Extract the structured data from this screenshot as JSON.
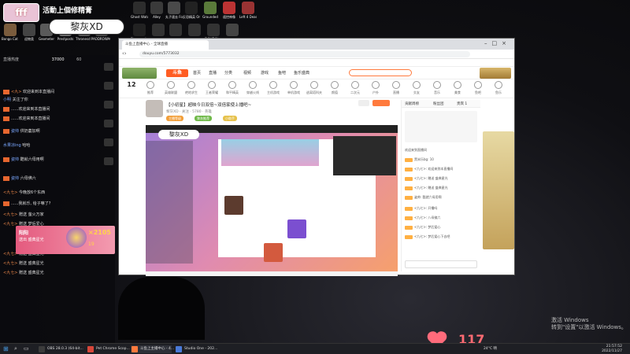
{
  "overlay": {
    "title_banner": "活動上個修精膏",
    "logo_badge": "fff",
    "streamer_name": "黎灰XD"
  },
  "desktop_icons_row1": [
    {
      "label": "Ghost Watchers",
      "color": "#2d2d2d"
    },
    {
      "label": "Alley",
      "color": "#3a3a3a"
    },
    {
      "label": "丸子速去 For Darling",
      "color": "#4a4a4a"
    },
    {
      "label": "反恐精英 Online",
      "color": "#222"
    },
    {
      "label": "Grounded",
      "color": "#5a7a3a"
    },
    {
      "label": "遥控神像",
      "color": "#b33"
    },
    {
      "label": "Left 4 Dead 2",
      "color": "#933"
    }
  ],
  "desktop_icons_row2": [
    {
      "label": "Bongo Cat Mver.exe",
      "color": "#7a5c3d"
    },
    {
      "label": "迎物类",
      "color": "#444"
    },
    {
      "label": "Geometer",
      "color": "#5a5a5a"
    },
    {
      "label": "Prestposts",
      "color": "#6a6a6a"
    },
    {
      "label": "Thronesd Party",
      "color": "#555"
    },
    {
      "label": "AODROWAGYE",
      "color": "#444"
    },
    {
      "label": "Phasmophobia",
      "color": "#222"
    },
    {
      "label": "",
      "color": "#333"
    },
    {
      "label": "",
      "color": "#333"
    },
    {
      "label": "",
      "color": "#333"
    },
    {
      "label": "FIGHT Phoenix",
      "color": "#333"
    },
    {
      "label": "",
      "color": "#444"
    }
  ],
  "chat": {
    "header_left": "直播热度",
    "header_count": "37000",
    "header_mid": "60",
    "lines": [
      {
        "user": "<九>",
        "msg": "欢迎来到本直播间"
      },
      {
        "user": "小明",
        "msg": "关注了你"
      },
      {
        "user": "",
        "msg": "......欢迎来到本直播间"
      },
      {
        "user": "",
        "msg": "......欢迎来到本直播间"
      },
      {
        "user": "姿帅",
        "msg": "供奶萎加啊"
      },
      {
        "user": "水果凉ing",
        "msg": "哈哈"
      },
      {
        "user": "姿帅",
        "msg": "酷就六母用啊"
      },
      {
        "user": "姿帅",
        "msg": "六母佛六"
      },
      {
        "user": "<九七>",
        "msg": "今晚放6个东西"
      },
      {
        "user": "",
        "msg": "......我就乐, 给子嘛了?"
      },
      {
        "user": "<九七>",
        "msg": "赠送 萤火万家"
      },
      {
        "user": "<九七>",
        "msg": "赠送 梦后爱心"
      },
      {
        "user": "<九七>",
        "msg": "赠送 盛典星光"
      },
      {
        "user": "<九七>",
        "msg": "赠送 盛典星光"
      },
      {
        "user": "<九七>",
        "msg": "赠送 盛典星光"
      }
    ],
    "gift_user": "阳阳",
    "gift_text": "送出 盛典星光",
    "gift_count": "×2105",
    "gift_num": "19"
  },
  "browser": {
    "tab_title": "斗鱼上直播中心 - 全球直播",
    "url": "douyu.com/5773032",
    "nav": [
      "首页",
      "直播",
      "分类",
      "视频",
      "游戏",
      "鱼吧",
      "鱼乐盛典"
    ],
    "categories": [
      "推荐",
      "英雄联盟",
      "绝地求生",
      "王者荣耀",
      "和平精英",
      "穿越火线",
      "主机游戏",
      "单机游戏",
      "逃离塔科夫",
      "颜值",
      "二次元",
      "户外",
      "直播",
      "交友",
      "音乐",
      "美食",
      "鱼吧",
      "鱼乐"
    ],
    "room_title": "【小初星】超映今日双倍~双倍家使上播吧~",
    "room_meta": "黎灰XD · 关注 · 5780 · 英雄",
    "tags": [
      "主播等级",
      "黎灰推荐",
      "小助手"
    ],
    "right_panel_lines": [
      "贡献周榜",
      "粉丝团",
      "贵宾 1",
      "欢迎来到直播间",
      "黑米乐bg: 10",
      "<九七>: 欢迎来到本直播间",
      "<九七>: 赠送 盛典星光",
      "<九七>: 赠送 盛典星光",
      "姿帅: 酷就六母用啊",
      "<九七>: 开播吗",
      "<九七>: 八母佛六",
      "<九七>: 梦后爱心",
      "<九七>: 梦后爱心下去吧"
    ],
    "room_number": "12"
  },
  "watermark": {
    "line1": "激活 Windows",
    "line2": "转到\"设置\"以激活 Windows。"
  },
  "hearts": {
    "count": "117"
  },
  "taskbar": {
    "items": [
      {
        "label": "OBS 28.0.3 (64-bit...",
        "color": "#3c3c3c"
      },
      {
        "label": "Pet Chrome Scop...",
        "color": "#d8473a"
      },
      {
        "label": "斗鱼上主播中心 - 4...",
        "color": "#ff7a3d"
      },
      {
        "label": "Studio One - 202...",
        "color": "#4a7ad8"
      }
    ],
    "weather": "24°C 晴",
    "time": "21:57:52",
    "date": "2022/11/27"
  }
}
